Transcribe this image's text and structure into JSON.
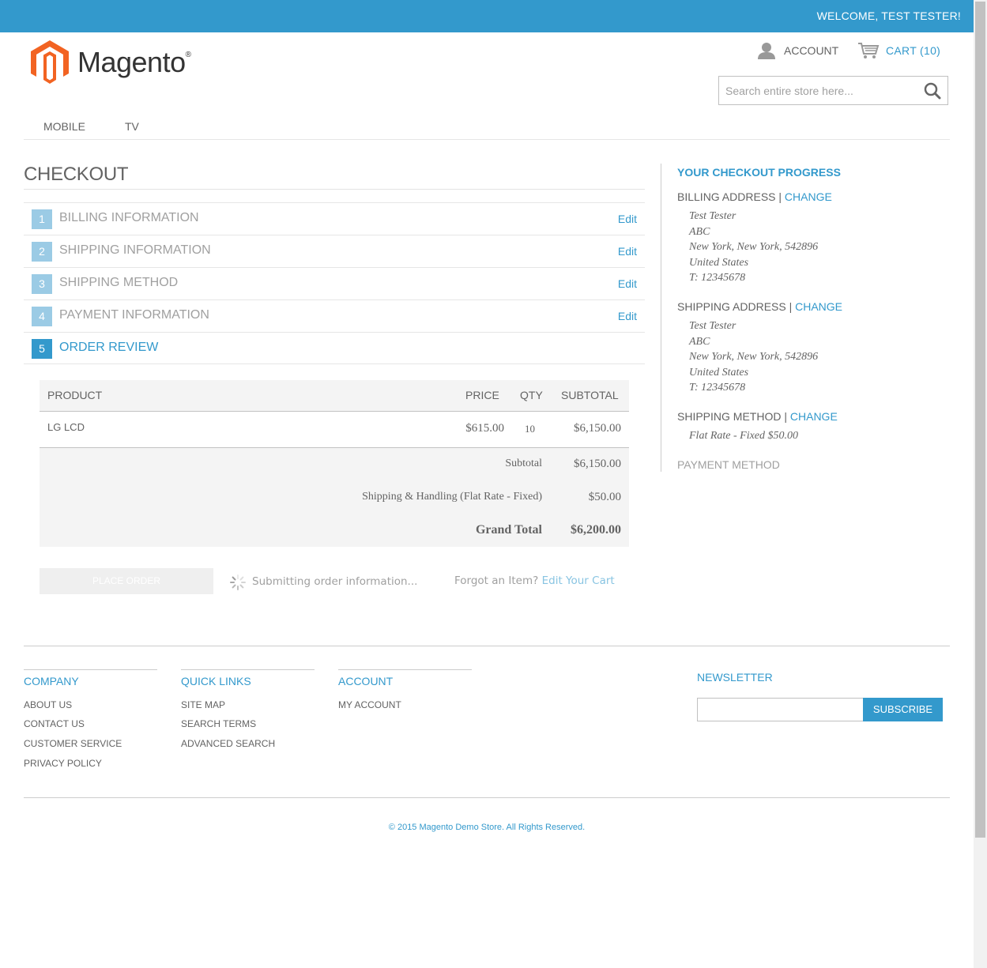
{
  "header": {
    "welcome": "WELCOME, TEST TESTER!",
    "logo_text": "Magento",
    "logo_reg": "®",
    "account_label": "ACCOUNT",
    "cart_label": "CART",
    "cart_count": "(10)",
    "search_placeholder": "Search entire store here..."
  },
  "nav": {
    "items": [
      "MOBILE",
      "TV"
    ]
  },
  "checkout": {
    "title": "CHECKOUT",
    "steps": [
      {
        "num": "1",
        "label": "BILLING INFORMATION",
        "edit": "Edit"
      },
      {
        "num": "2",
        "label": "SHIPPING INFORMATION",
        "edit": "Edit"
      },
      {
        "num": "3",
        "label": "SHIPPING METHOD",
        "edit": "Edit"
      },
      {
        "num": "4",
        "label": "PAYMENT INFORMATION",
        "edit": "Edit"
      },
      {
        "num": "5",
        "label": "ORDER REVIEW"
      }
    ],
    "table": {
      "headers": [
        "PRODUCT",
        "PRICE",
        "QTY",
        "SUBTOTAL"
      ],
      "rows": [
        {
          "product": "LG LCD",
          "price": "$615.00",
          "qty": "10",
          "subtotal": "$6,150.00"
        }
      ],
      "totals": [
        {
          "label": "Subtotal",
          "value": "$6,150.00"
        },
        {
          "label": "Shipping & Handling (Flat Rate - Fixed)",
          "value": "$50.00"
        },
        {
          "label": "Grand Total",
          "value": "$6,200.00"
        }
      ]
    },
    "place_order": "PLACE ORDER",
    "submitting": "Submitting order information...",
    "forgot": "Forgot an Item?",
    "edit_cart": "Edit Your Cart"
  },
  "progress": {
    "title": "YOUR CHECKOUT PROGRESS",
    "billing_title": "BILLING ADDRESS",
    "shipping_title": "SHIPPING ADDRESS",
    "method_title": "SHIPPING METHOD",
    "payment_title": "PAYMENT METHOD",
    "change": "CHANGE",
    "separator": "|",
    "billing_lines": [
      "Test Tester",
      "ABC",
      "New York, New York, 542896",
      "United States",
      "T: 12345678"
    ],
    "shipping_lines": [
      "Test Tester",
      "ABC",
      "New York, New York, 542896",
      "United States",
      "T: 12345678"
    ],
    "method_text": "Flat Rate - Fixed $50.00"
  },
  "footer": {
    "company_title": "COMPANY",
    "company_links": [
      "ABOUT US",
      "CONTACT US",
      "CUSTOMER SERVICE",
      "PRIVACY POLICY"
    ],
    "quick_title": "QUICK LINKS",
    "quick_links": [
      "SITE MAP",
      "SEARCH TERMS",
      "ADVANCED SEARCH"
    ],
    "account_title": "ACCOUNT",
    "account_links": [
      "MY ACCOUNT"
    ],
    "newsletter_title": "NEWSLETTER",
    "subscribe": "SUBSCRIBE",
    "copyright": "© 2015 Magento Demo Store. All Rights Reserved."
  },
  "colors": {
    "accent": "#3399cc",
    "text": "#636363",
    "muted": "#a0a0a0",
    "logo": "#f26322"
  }
}
